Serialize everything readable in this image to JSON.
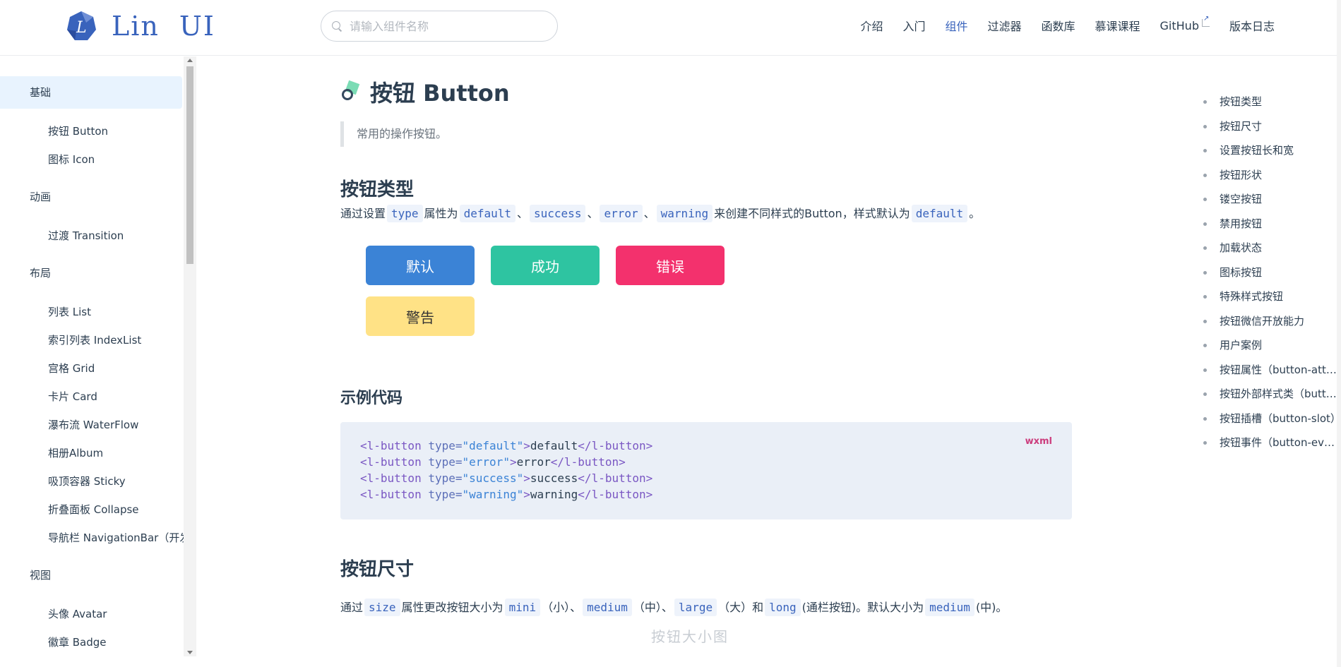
{
  "header": {
    "logo": {
      "text1": "Lin",
      "text2": "UI",
      "brand_color": "#3963bc"
    },
    "search": {
      "placeholder": "请输入组件名称",
      "value": ""
    },
    "nav": [
      {
        "label": "介绍",
        "active": false
      },
      {
        "label": "入门",
        "active": false
      },
      {
        "label": "组件",
        "active": true
      },
      {
        "label": "过滤器",
        "active": false
      },
      {
        "label": "函数库",
        "active": false
      },
      {
        "label": "慕课课程",
        "active": false
      },
      {
        "label": "GitHub",
        "active": false,
        "external": true
      },
      {
        "label": "版本日志",
        "active": false
      }
    ]
  },
  "sidebar": {
    "groups": [
      {
        "label": "基础",
        "active": true,
        "items": [
          "按钮 Button",
          "图标 Icon"
        ]
      },
      {
        "label": "动画",
        "active": false,
        "items": [
          "过渡 Transition"
        ]
      },
      {
        "label": "布局",
        "active": false,
        "items": [
          "列表 List",
          "索引列表 IndexList",
          "宫格 Grid",
          "卡片 Card",
          "瀑布流 WaterFlow",
          "相册Album",
          "吸顶容器 Sticky",
          "折叠面板 Collapse",
          "导航栏 NavigationBar（开发中）"
        ]
      },
      {
        "label": "视图",
        "active": false,
        "items": [
          "头像 Avatar",
          "徽章 Badge"
        ]
      }
    ]
  },
  "main": {
    "title": "按钮 Button",
    "subtitle": "常用的操作按钮。",
    "section_types": {
      "heading": "按钮类型",
      "desc": {
        "p1": "通过设置",
        "c1": "type",
        "p2": "属性为",
        "c2": "default",
        "sep1": "、",
        "c3": "success",
        "sep2": "、",
        "c4": "error",
        "sep3": "、",
        "c5": "warning",
        "p3": "来创建不同样式的Button，样式默认为",
        "c6": "default",
        "p4": "。"
      },
      "buttons": {
        "default": "默认",
        "success": "成功",
        "error": "错误",
        "warning": "警告"
      },
      "colors": {
        "default": "#3b83d6",
        "success": "#2ec4a1",
        "error": "#f3316d",
        "warning": "#ffe286"
      }
    },
    "example": {
      "heading": "示例代码",
      "lang": "wxml",
      "lines": [
        {
          "tag": "l-button",
          "attr": "type",
          "val": "default",
          "text": "default"
        },
        {
          "tag": "l-button",
          "attr": "type",
          "val": "error",
          "text": "error"
        },
        {
          "tag": "l-button",
          "attr": "type",
          "val": "success",
          "text": "success"
        },
        {
          "tag": "l-button",
          "attr": "type",
          "val": "warning",
          "text": "warning"
        }
      ]
    },
    "section_size": {
      "heading": "按钮尺寸",
      "desc": {
        "p1": "通过",
        "c1": "size",
        "p2": "属性更改按钮大小为",
        "c2": "mini",
        "p3": "（小）、",
        "c3": "medium",
        "p4": "（中）、",
        "c4": "large",
        "p5": "（大）和",
        "c5": "long",
        "p6": "(通栏按钮)。默认大小为",
        "c6": "medium",
        "p7": "(中)。"
      },
      "faded": "按钮大小图"
    }
  },
  "toc": [
    "按钮类型",
    "按钮尺寸",
    "设置按钮长和宽",
    "按钮形状",
    "镂空按钮",
    "禁用按钮",
    "加载状态",
    "图标按钮",
    "特殊样式按钮",
    "按钮微信开放能力",
    "用户案例",
    "按钮属性（button-attributes）",
    "按钮外部样式类（button-external-classes）",
    "按钮插槽（button-slot）",
    "按钮事件（button-events）"
  ]
}
